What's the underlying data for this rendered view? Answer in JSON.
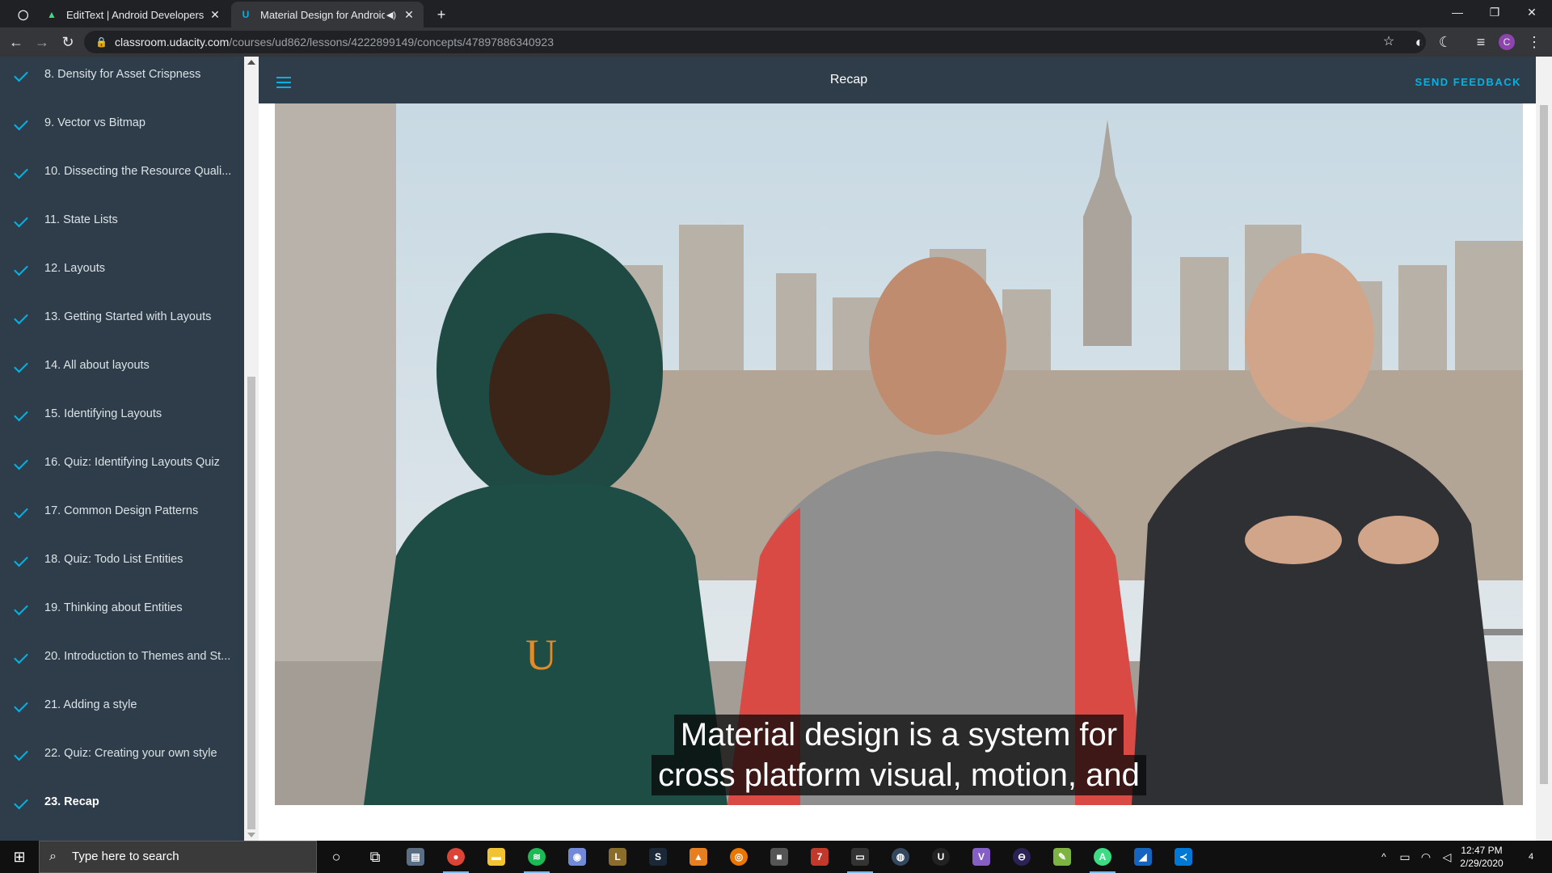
{
  "browser": {
    "tabs": [
      {
        "title": "EditText | Android Developers",
        "icon": "android-developers-icon"
      },
      {
        "title": "Material Design for Android",
        "icon": "udacity-icon",
        "active": true
      }
    ],
    "url_host": "classroom.udacity.com",
    "url_path": "/courses/ud862/lessons/4222899149/concepts/47897886340923",
    "profile_initial": "C"
  },
  "sidebar": {
    "items": [
      {
        "label": "8. Density for Asset Crispness"
      },
      {
        "label": "9. Vector vs Bitmap"
      },
      {
        "label": "10. Dissecting the Resource Quali..."
      },
      {
        "label": "11. State Lists"
      },
      {
        "label": "12. Layouts"
      },
      {
        "label": "13. Getting Started with Layouts"
      },
      {
        "label": "14. All about layouts"
      },
      {
        "label": "15. Identifying Layouts"
      },
      {
        "label": "16. Quiz: Identifying Layouts Quiz"
      },
      {
        "label": "17. Common Design Patterns"
      },
      {
        "label": "18. Quiz: Todo List Entities"
      },
      {
        "label": "19. Thinking about Entities"
      },
      {
        "label": "20. Introduction to Themes and St..."
      },
      {
        "label": "21. Adding a style"
      },
      {
        "label": "22. Quiz: Creating your own style"
      },
      {
        "label": "23. Recap",
        "active": true
      }
    ]
  },
  "header": {
    "title": "Recap",
    "feedback": "SEND FEEDBACK"
  },
  "video": {
    "caption_line1": "Material design is a system for",
    "caption_line2": "cross platform visual, motion, and"
  },
  "taskbar": {
    "search_placeholder": "Type here to search",
    "time": "12:47 PM",
    "date": "2/29/2020",
    "notifications": "4"
  },
  "colors": {
    "accent": "#02b3e4",
    "sidebar": "#2e3d49",
    "chrome_dark": "#202124"
  }
}
